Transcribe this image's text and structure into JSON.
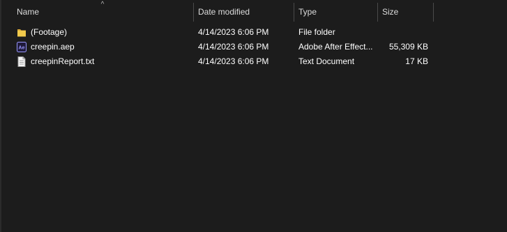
{
  "columns": {
    "name": "Name",
    "date": "Date modified",
    "type": "Type",
    "size": "Size"
  },
  "sort_indicator": "^",
  "files": [
    {
      "name": "(Footage)",
      "date": "4/14/2023 6:06 PM",
      "type": "File folder",
      "size": "",
      "icon": "folder-icon"
    },
    {
      "name": "creepin.aep",
      "date": "4/14/2023 6:06 PM",
      "type": "Adobe After Effect...",
      "size": "55,309 KB",
      "icon": "after-effects-file-icon"
    },
    {
      "name": "creepinReport.txt",
      "date": "4/14/2023 6:06 PM",
      "type": "Text Document",
      "size": "17 KB",
      "icon": "text-document-icon"
    }
  ],
  "colors": {
    "background": "#1c1c1c",
    "folder": "#f0c94b",
    "after_effects": "#9999ff",
    "after_effects_bg": "#1f1a3a"
  }
}
